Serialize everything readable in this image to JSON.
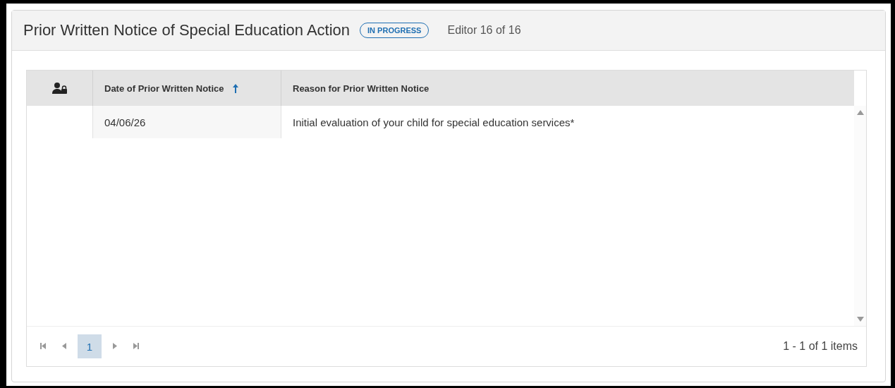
{
  "header": {
    "title": "Prior Written Notice of Special Education Action",
    "status": "IN PROGRESS",
    "editor": "Editor 16 of 16"
  },
  "table": {
    "columns": [
      {
        "kind": "icon"
      },
      {
        "kind": "text",
        "label": "Date of Prior Written Notice",
        "sorted": true
      },
      {
        "kind": "text",
        "label": "Reason for Prior Written Notice",
        "sorted": false
      }
    ],
    "rows": [
      [
        "",
        "04/06/26",
        "Initial evaluation of your child for special education services*"
      ]
    ]
  },
  "pager": {
    "pages": [
      {
        "label": "1",
        "selected": true
      }
    ],
    "summary": "1 - 1 of 1 items"
  }
}
